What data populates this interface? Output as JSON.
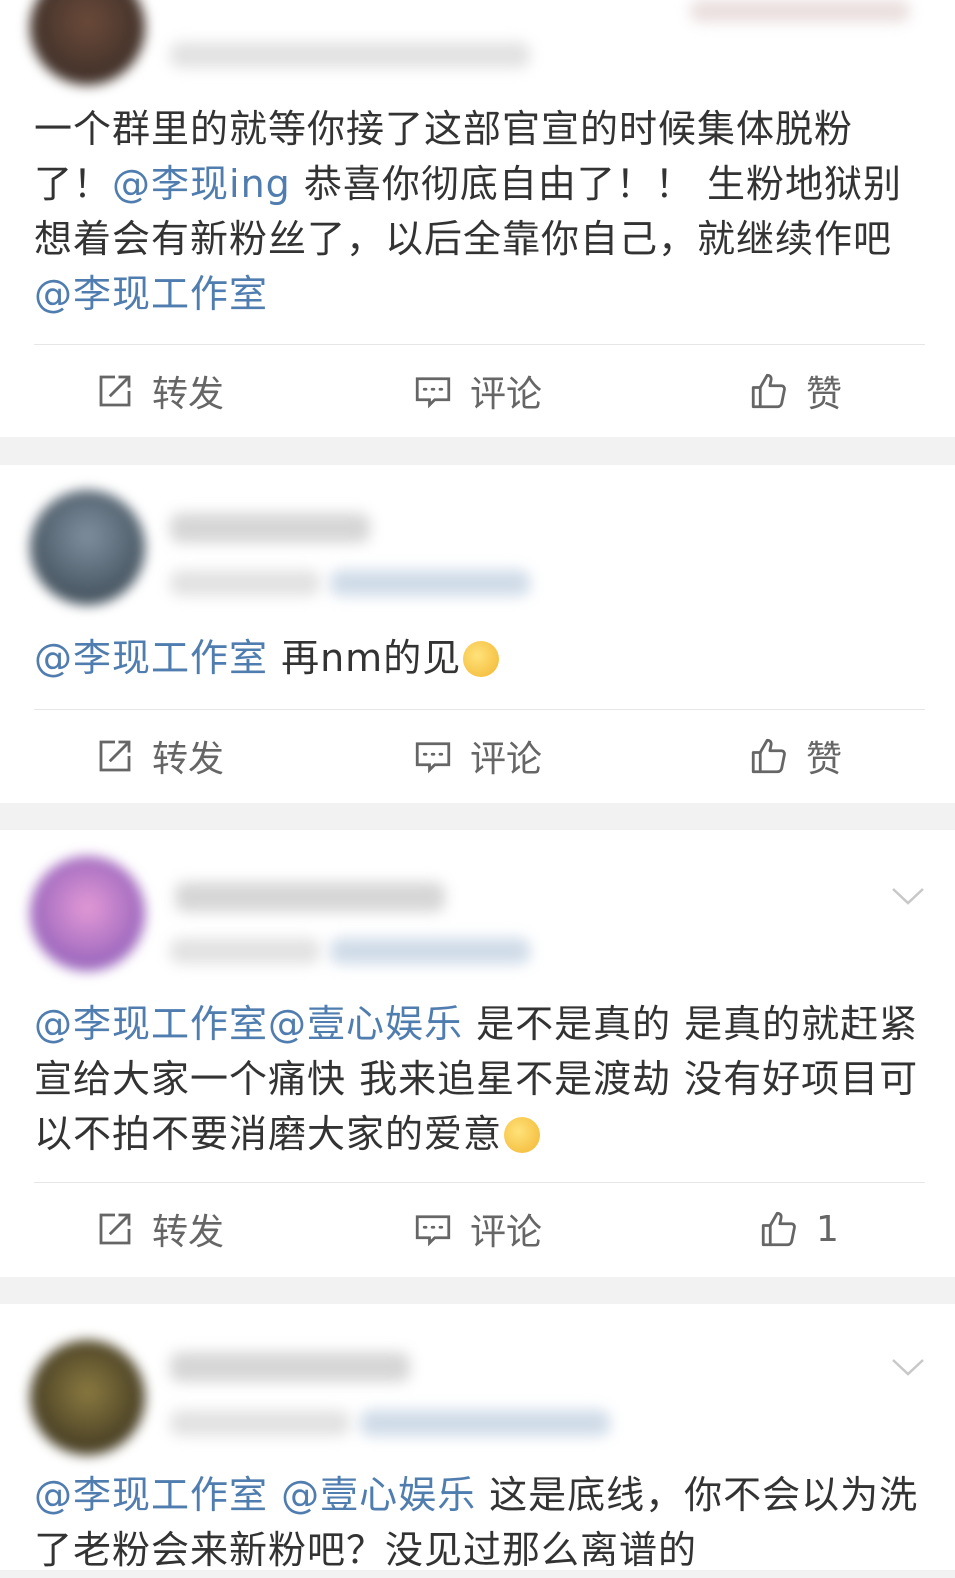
{
  "posts": [
    {
      "id": 1,
      "segments": [
        {
          "type": "text",
          "value": "一个群里的就等你接了这部官宣的时候集体脱粉了！"
        },
        {
          "type": "mention",
          "value": "@李现ing"
        },
        {
          "type": "text",
          "value": " 恭喜你彻底自由了！！ 生粉地狱别想着会有新粉丝了，以后全靠你自己，就继续作吧 "
        },
        {
          "type": "mention",
          "value": "@李现工作室"
        }
      ],
      "actions": {
        "repost": "转发",
        "comment": "评论",
        "like": "赞"
      }
    },
    {
      "id": 2,
      "segments": [
        {
          "type": "mention",
          "value": "@李现工作室"
        },
        {
          "type": "text",
          "value": " 再nm的见"
        },
        {
          "type": "emoji",
          "value": "thinking-emoji"
        }
      ],
      "actions": {
        "repost": "转发",
        "comment": "评论",
        "like": "赞"
      }
    },
    {
      "id": 3,
      "segments": [
        {
          "type": "mention",
          "value": "@李现工作室@壹心娱乐"
        },
        {
          "type": "text",
          "value": " 是不是真的 是真的就赶紧宣给大家一个痛快 我来追星不是渡劫 没有好项目可以不拍不要消磨大家的爱意"
        },
        {
          "type": "emoji",
          "value": "relieved-emoji"
        }
      ],
      "actions": {
        "repost": "转发",
        "comment": "评论",
        "like": "1"
      }
    },
    {
      "id": 4,
      "segments": [
        {
          "type": "mention",
          "value": "@李现工作室 @壹心娱乐"
        },
        {
          "type": "text",
          "value": " 这是底线，你不会以为洗了老粉会来新粉吧？没见过那么离谱的"
        }
      ]
    }
  ],
  "colors": {
    "mention": "#507daf",
    "text": "#333333",
    "action": "#666666",
    "separator": "#f2f2f2"
  },
  "icons": {
    "repost": "repost-icon",
    "comment": "comment-icon",
    "like": "thumbs-up-icon",
    "more": "chevron-down-icon"
  }
}
